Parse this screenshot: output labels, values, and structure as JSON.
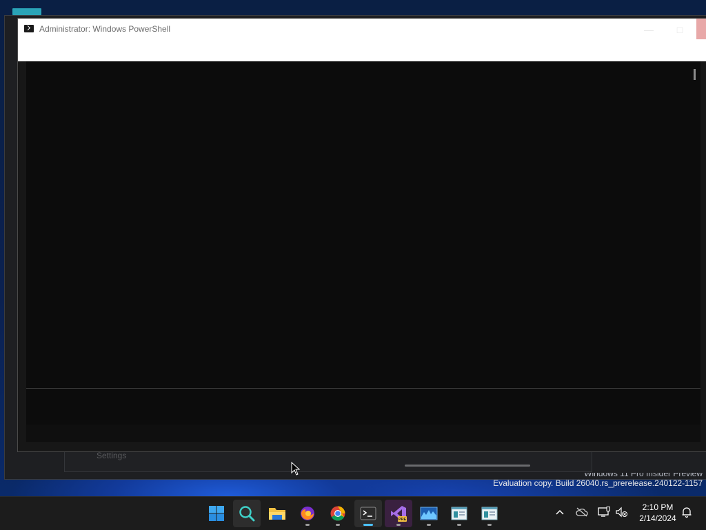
{
  "window": {
    "title": "Administrator: Windows PowerShell"
  },
  "background_window": {
    "settings_label": "Settings"
  },
  "watermark": {
    "line1": "Windows 11 Pro Insider Preview",
    "line2": "Evaluation copy. Build 26040.rs_prerelease.240122-1157"
  },
  "taskbar": {
    "apps": [
      {
        "name": "start",
        "icon": "windows-logo-icon"
      },
      {
        "name": "search",
        "icon": "search-icon"
      },
      {
        "name": "file-explorer",
        "icon": "folder-icon"
      },
      {
        "name": "firefox",
        "icon": "firefox-icon"
      },
      {
        "name": "chrome",
        "icon": "chrome-icon"
      },
      {
        "name": "terminal",
        "icon": "terminal-icon",
        "active": true
      },
      {
        "name": "visual-studio-preview",
        "icon": "visual-studio-icon",
        "badge": "PRE"
      },
      {
        "name": "performance-monitor",
        "icon": "chart-icon"
      },
      {
        "name": "app-window-1",
        "icon": "app-window-icon"
      },
      {
        "name": "app-window-2",
        "icon": "app-window-icon"
      }
    ],
    "tray": {
      "time": "2:10 PM",
      "date": "2/14/2024"
    }
  },
  "colors": {
    "taskbar_bg": "#1c1c1c",
    "console_bg": "#0c0c0c",
    "accent": "#4cc2ff"
  }
}
